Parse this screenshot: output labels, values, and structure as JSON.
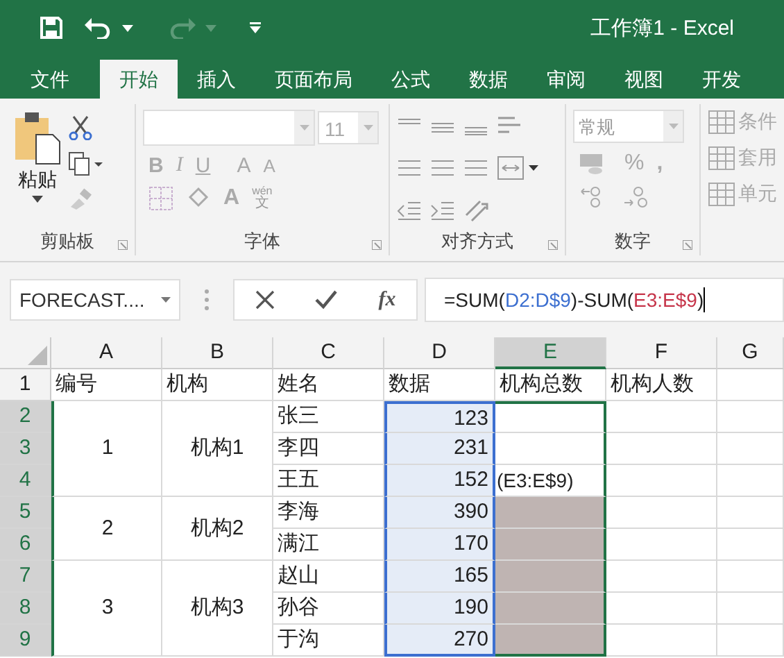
{
  "title_bar": {
    "title": "工作簿1 - Excel"
  },
  "ribbon_tabs": [
    {
      "label": "文件",
      "selected": false
    },
    {
      "label": "开始",
      "selected": true
    },
    {
      "label": "插入",
      "selected": false
    },
    {
      "label": "页面布局",
      "selected": false
    },
    {
      "label": "公式",
      "selected": false
    },
    {
      "label": "数据",
      "selected": false
    },
    {
      "label": "审阅",
      "selected": false
    },
    {
      "label": "视图",
      "selected": false
    },
    {
      "label": "开发",
      "selected": false
    }
  ],
  "ribbon": {
    "paste_label": "粘贴",
    "font_size": "11",
    "font_buttons": [
      "B",
      "I",
      "U"
    ],
    "grow_font": "A",
    "shrink_font": "A",
    "font_color": "A",
    "phonetic": "wén",
    "phonetic_char": "文",
    "number_format": "常规",
    "percent": "%",
    "comma": ",",
    "styles": [
      "条件",
      "套用",
      "单元"
    ],
    "groups": [
      "剪贴板",
      "字体",
      "对齐方式",
      "数字"
    ]
  },
  "formula_bar": {
    "name_box": "FORECAST....",
    "fx": "fx",
    "formula": [
      {
        "text": "=SUM(",
        "color": "#222222"
      },
      {
        "text": "D2:D$9",
        "color": "#3c6fd0"
      },
      {
        "text": ")-SUM(",
        "color": "#222222"
      },
      {
        "text": "E3:E$9",
        "color": "#c6354a"
      },
      {
        "text": ")",
        "color": "#222222"
      }
    ]
  },
  "sheet": {
    "columns": [
      {
        "label": "A",
        "selected": false
      },
      {
        "label": "B",
        "selected": false
      },
      {
        "label": "C",
        "selected": false
      },
      {
        "label": "D",
        "selected": false
      },
      {
        "label": "E",
        "selected": true
      },
      {
        "label": "F",
        "selected": false
      },
      {
        "label": "G",
        "selected": false
      }
    ],
    "header_row": {
      "number": "1",
      "selected": false,
      "cells": [
        "编号",
        "机构",
        "姓名",
        "数据",
        "机构总数",
        "机构人数"
      ]
    },
    "groups": [
      {
        "id": "1",
        "org": "机构1",
        "people": [
          {
            "number": "2",
            "selected": true,
            "name": "张三",
            "value": "123",
            "shaded": false
          },
          {
            "number": "3",
            "selected": true,
            "name": "李四",
            "value": "231",
            "shaded": false
          },
          {
            "number": "4",
            "selected": true,
            "name": "王五",
            "value": "152",
            "shaded": false,
            "edit_text": "(E3:E$9)"
          }
        ]
      },
      {
        "id": "2",
        "org": "机构2",
        "people": [
          {
            "number": "5",
            "selected": true,
            "name": "李海",
            "value": "390",
            "shaded": true
          },
          {
            "number": "6",
            "selected": true,
            "name": "满江",
            "value": "170",
            "shaded": true
          }
        ]
      },
      {
        "id": "3",
        "org": "机构3",
        "people": [
          {
            "number": "7",
            "selected": true,
            "name": "赵山",
            "value": "165",
            "shaded": true
          },
          {
            "number": "8",
            "selected": true,
            "name": "孙谷",
            "value": "190",
            "shaded": true
          },
          {
            "number": "9",
            "selected": true,
            "name": "于沟",
            "value": "270",
            "shaded": true
          }
        ]
      }
    ]
  }
}
